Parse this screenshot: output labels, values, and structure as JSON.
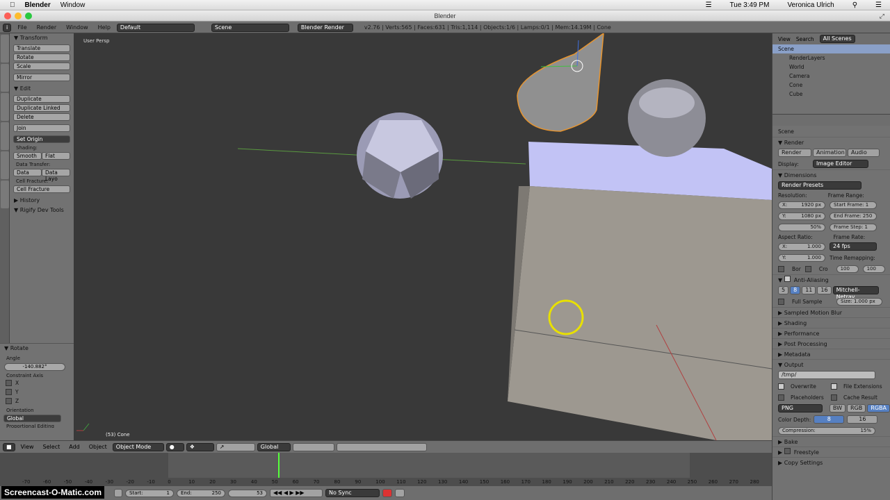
{
  "mac": {
    "app": "Blender",
    "menu": [
      "Window"
    ],
    "clock": "Tue 3:49 PM",
    "user": "Veronica Ulrich"
  },
  "window": {
    "title": "Blender"
  },
  "info": {
    "menus": [
      "File",
      "Render",
      "Window",
      "Help"
    ],
    "screen": "Default",
    "scene": "Scene",
    "engine": "Blender Render",
    "stats": "v2.76 | Verts:565 | Faces:631 | Tris:1,114 | Objects:1/6 | Lamps:0/1 | Mem:14.19M | Cone"
  },
  "toolshelf": {
    "transform_title": "Transform",
    "transform": [
      "Translate",
      "Rotate",
      "Scale",
      "Mirror"
    ],
    "edit_title": "Edit",
    "edit": [
      "Duplicate",
      "Duplicate Linked",
      "Delete",
      "Join"
    ],
    "set_origin": "Set Origin",
    "shading_label": "Shading:",
    "smooth": "Smooth",
    "flat": "Flat",
    "data_transfer_label": "Data Transfer:",
    "data": "Data",
    "data_layo": "Data Layo",
    "cell_fracture_label": "Cell Fracture:",
    "cell_fracture": "Cell Fracture",
    "history": "History",
    "rigify": "Rigify Dev Tools"
  },
  "operator": {
    "title": "Rotate",
    "angle_label": "Angle",
    "angle": "-140.882°",
    "constraint_label": "Constraint Axis",
    "axes": [
      "X",
      "Y",
      "Z"
    ],
    "orientation_label": "Orientation",
    "orientation": "Global",
    "proportional": "Proportional Editing"
  },
  "viewport": {
    "view_label": "User Persp",
    "object_label": "(53) Cone"
  },
  "vpheader": {
    "menus": [
      "View",
      "Select",
      "Add",
      "Object"
    ],
    "mode": "Object Mode",
    "orientation": "Global"
  },
  "timeline": {
    "ticks": [
      "-70",
      "-60",
      "-50",
      "-40",
      "-30",
      "-20",
      "-10",
      "0",
      "10",
      "20",
      "30",
      "40",
      "50",
      "60",
      "70",
      "80",
      "90",
      "100",
      "110",
      "120",
      "130",
      "140",
      "150",
      "160",
      "170",
      "180",
      "190",
      "200",
      "210",
      "220",
      "230",
      "240",
      "250",
      "260",
      "270",
      "280"
    ],
    "current_frame": 53
  },
  "tlfooter": {
    "start_label": "Start:",
    "start": "1",
    "end_label": "End:",
    "end": "250",
    "frame": "53",
    "sync": "No Sync"
  },
  "watermark": "Screencast-O-Matic.com",
  "outliner": {
    "tabs": [
      "View",
      "Search",
      "All Scenes"
    ],
    "items": [
      "Scene",
      "RenderLayers",
      "World",
      "Camera",
      "Cone",
      "Cube"
    ]
  },
  "props": {
    "context": "Scene",
    "render_title": "Render",
    "render_btns": [
      "Render",
      "Animation",
      "Audio"
    ],
    "display_label": "Display:",
    "display": "Image Editor",
    "dimensions": "Dimensions",
    "presets": "Render Presets",
    "resolution": "Resolution:",
    "res_x": "X:",
    "res_x_val": "1920 px",
    "res_y": "Y:",
    "res_y_val": "1080 px",
    "res_pct": "50%",
    "frame_range": "Frame Range:",
    "start_frame": "Start Frame: 1",
    "end_frame": "End Frame: 250",
    "frame_step": "Frame Step: 1",
    "aspect": "Aspect Ratio:",
    "asp_x": "X:",
    "asp_x_val": "1.000",
    "asp_y": "Y:",
    "asp_y_val": "1.000",
    "frame_rate": "Frame Rate:",
    "fps": "24 fps",
    "bor": "Bor",
    "cro": "Cro",
    "time_remap": "Time Remapping:",
    "remap_a": "100",
    "remap_b": "100",
    "aa": "Anti-Aliasing",
    "aa_samples": [
      "5",
      "8",
      "11",
      "16"
    ],
    "filter": "Mitchell-Netrav...",
    "full_sample": "Full Sample",
    "size": "Size: 1.000 px",
    "sections": [
      "Sampled Motion Blur",
      "Shading",
      "Performance",
      "Post Processing",
      "Metadata"
    ],
    "output": "Output",
    "path": "/tmp/",
    "overwrite": "Overwrite",
    "file_ext": "File Extensions",
    "placeholders": "Placeholders",
    "cache": "Cache Result",
    "format": "PNG",
    "bw": "BW",
    "rgb": "RGB",
    "rgba": "RGBA",
    "color_depth": "Color Depth:",
    "depth_8": "8",
    "depth_16": "16",
    "compression": "Compression:",
    "compression_val": "15%",
    "bake": "Bake",
    "freestyle": "Freestyle",
    "copy_settings": "Copy Settings"
  }
}
